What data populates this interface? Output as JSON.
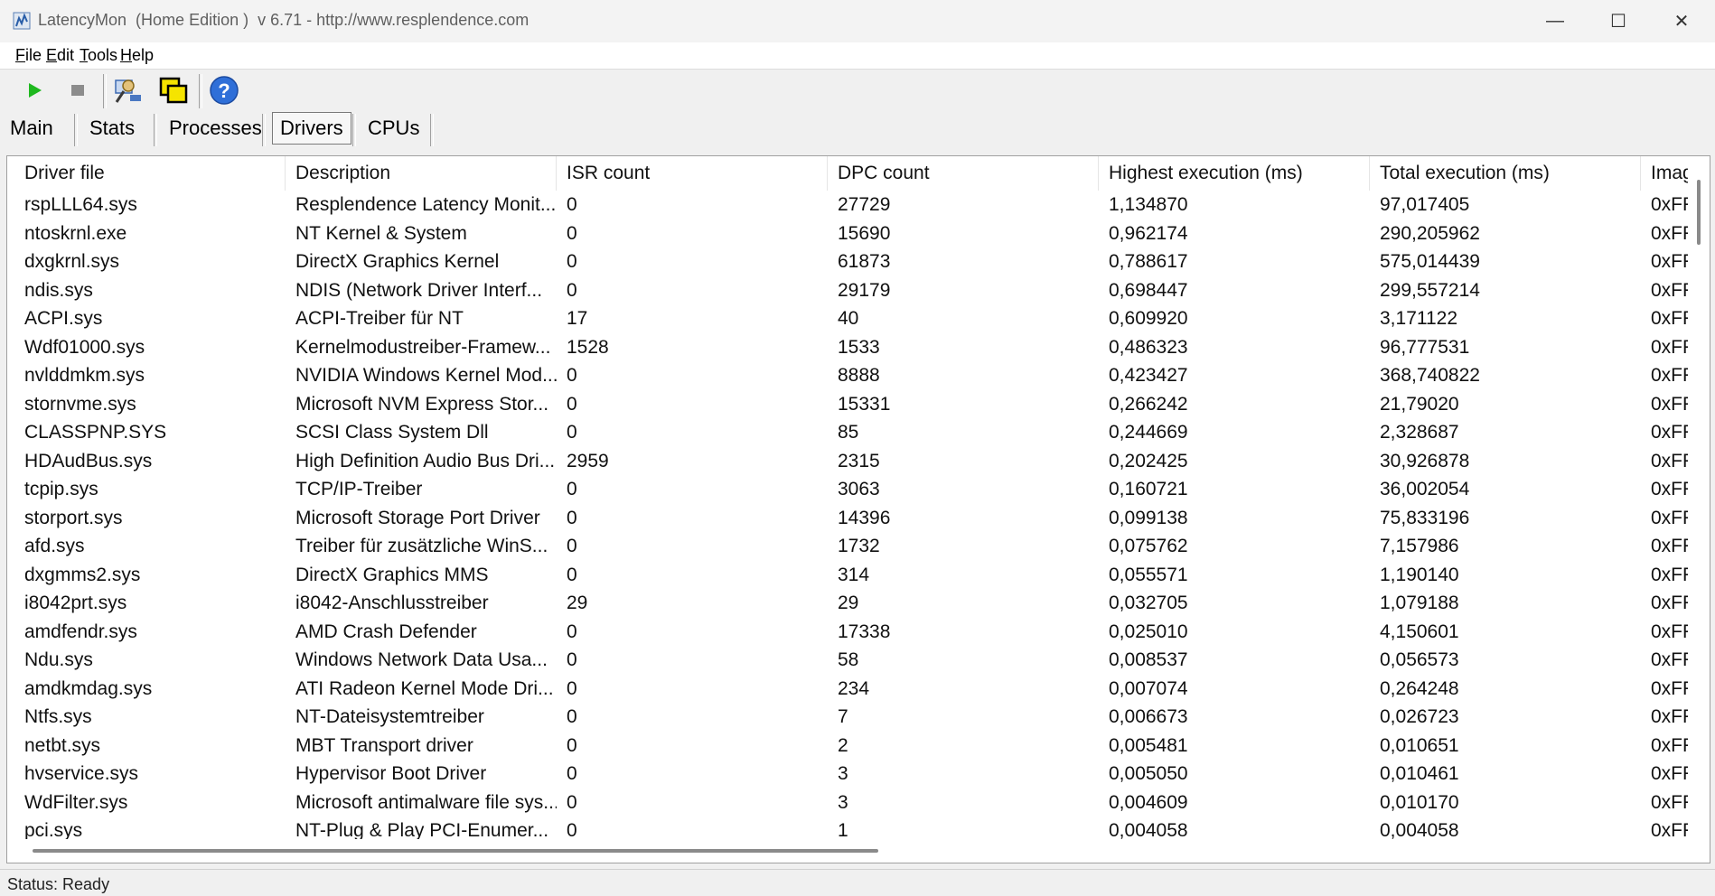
{
  "window": {
    "title": "LatencyMon  (Home Edition )  v 6.71 - http://www.resplendence.com",
    "minimize_glyph": "—",
    "maximize_glyph": "☐",
    "close_glyph": "✕"
  },
  "menu": [
    {
      "key": "F",
      "rest": "ile"
    },
    {
      "key": "E",
      "rest": "dit"
    },
    {
      "key": "T",
      "rest": "ools"
    },
    {
      "key": "H",
      "rest": "elp"
    }
  ],
  "toolbar": {
    "icons": [
      "play-icon",
      "stop-icon",
      "analyze-icon",
      "windows-icon",
      "help-icon"
    ]
  },
  "tabs": [
    "Main",
    "Stats",
    "Processes",
    "Drivers",
    "CPUs"
  ],
  "active_tab": "Drivers",
  "grid": {
    "columns": [
      "Driver file",
      "Description",
      "ISR count",
      "DPC count",
      "Highest execution (ms)",
      "Total execution (ms)",
      "Imag"
    ],
    "rows": [
      [
        "rspLLL64.sys",
        "Resplendence Latency Monit...",
        "0",
        "27729",
        "1,134870",
        "97,017405",
        "0xFF"
      ],
      [
        "ntoskrnl.exe",
        "NT Kernel & System",
        "0",
        "15690",
        "0,962174",
        "290,205962",
        "0xFF"
      ],
      [
        "dxgkrnl.sys",
        "DirectX Graphics Kernel",
        "0",
        "61873",
        "0,788617",
        "575,014439",
        "0xFF"
      ],
      [
        "ndis.sys",
        "NDIS (Network Driver Interf...",
        "0",
        "29179",
        "0,698447",
        "299,557214",
        "0xFF"
      ],
      [
        "ACPI.sys",
        "ACPI-Treiber für NT",
        "17",
        "40",
        "0,609920",
        "3,171122",
        "0xFF"
      ],
      [
        "Wdf01000.sys",
        "Kernelmodustreiber-Framew...",
        "1528",
        "1533",
        "0,486323",
        "96,777531",
        "0xFF"
      ],
      [
        "nvlddmkm.sys",
        "NVIDIA Windows Kernel Mod...",
        "0",
        "8888",
        "0,423427",
        "368,740822",
        "0xFF"
      ],
      [
        "stornvme.sys",
        "Microsoft NVM Express Stor...",
        "0",
        "15331",
        "0,266242",
        "21,79020",
        "0xFF"
      ],
      [
        "CLASSPNP.SYS",
        "SCSI Class System Dll",
        "0",
        "85",
        "0,244669",
        "2,328687",
        "0xFF"
      ],
      [
        "HDAudBus.sys",
        "High Definition Audio Bus Dri...",
        "2959",
        "2315",
        "0,202425",
        "30,926878",
        "0xFF"
      ],
      [
        "tcpip.sys",
        "TCP/IP-Treiber",
        "0",
        "3063",
        "0,160721",
        "36,002054",
        "0xFF"
      ],
      [
        "storport.sys",
        "Microsoft Storage Port Driver",
        "0",
        "14396",
        "0,099138",
        "75,833196",
        "0xFF"
      ],
      [
        "afd.sys",
        "Treiber für zusätzliche WinS...",
        "0",
        "1732",
        "0,075762",
        "7,157986",
        "0xFF"
      ],
      [
        "dxgmms2.sys",
        "DirectX Graphics MMS",
        "0",
        "314",
        "0,055571",
        "1,190140",
        "0xFF"
      ],
      [
        "i8042prt.sys",
        "i8042-Anschlusstreiber",
        "29",
        "29",
        "0,032705",
        "1,079188",
        "0xFF"
      ],
      [
        "amdfendr.sys",
        "AMD Crash Defender",
        "0",
        "17338",
        "0,025010",
        "4,150601",
        "0xFF"
      ],
      [
        "Ndu.sys",
        "Windows Network Data Usa...",
        "0",
        "58",
        "0,008537",
        "0,056573",
        "0xFF"
      ],
      [
        "amdkmdag.sys",
        "ATI Radeon Kernel Mode Dri...",
        "0",
        "234",
        "0,007074",
        "0,264248",
        "0xFF"
      ],
      [
        "Ntfs.sys",
        "NT-Dateisystemtreiber",
        "0",
        "7",
        "0,006673",
        "0,026723",
        "0xFF"
      ],
      [
        "netbt.sys",
        "MBT Transport driver",
        "0",
        "2",
        "0,005481",
        "0,010651",
        "0xFF"
      ],
      [
        "hvservice.sys",
        "Hypervisor Boot Driver",
        "0",
        "3",
        "0,005050",
        "0,010461",
        "0xFF"
      ],
      [
        "WdFilter.sys",
        "Microsoft antimalware file sys...",
        "0",
        "3",
        "0,004609",
        "0,010170",
        "0xFF"
      ],
      [
        "pci.sys",
        "NT-Plug & Play PCI-Enumer...",
        "0",
        "1",
        "0,004058",
        "0,004058",
        "0xFF"
      ]
    ]
  },
  "status": "Status: Ready"
}
